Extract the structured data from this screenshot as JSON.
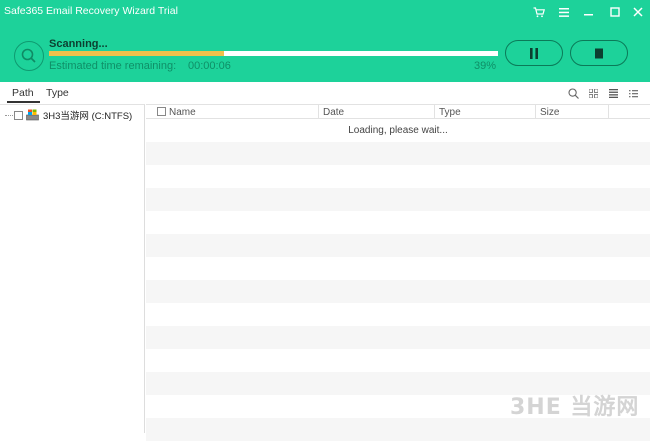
{
  "app": {
    "title": "Safe365 Email Recovery Wizard Trial"
  },
  "window_controls": [
    "cart-icon",
    "menu-icon",
    "minimize-icon",
    "maximize-icon",
    "close-icon"
  ],
  "scan": {
    "status": "Scanning...",
    "estimated_label": "Estimated time remaining:",
    "estimated_time": "00:00:06",
    "percent_text": "39%",
    "progress": 0.39
  },
  "tabs": [
    "Path",
    "Type"
  ],
  "tree": {
    "drive_label": "3H3当游网 (C:NTFS)"
  },
  "table": {
    "columns": [
      "Name",
      "Date",
      "Type",
      "Size"
    ],
    "loading_text": "Loading, please wait..."
  },
  "watermark": "3HE 当游网",
  "colors": {
    "header": "#1dd29a",
    "progress_fill": "#f0c14b",
    "row_alt": "#f6f6f6"
  }
}
